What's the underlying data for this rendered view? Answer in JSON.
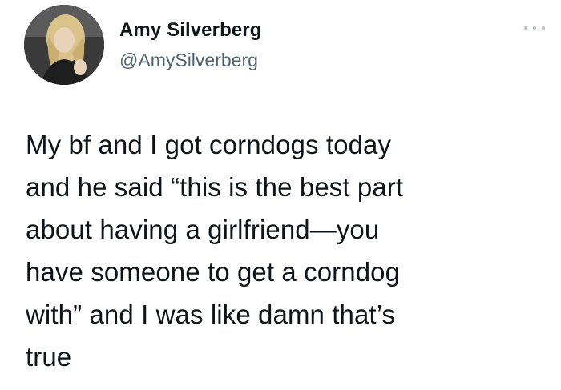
{
  "tweet": {
    "author": {
      "display_name": "Amy Silverberg",
      "handle": "@AmySilverberg",
      "avatar_icon": "user-avatar"
    },
    "more_icon": "more-options-icon",
    "text_lines": [
      "My bf and I got corndogs today",
      "and he said “this is the best part",
      "about having a girlfriend—you",
      "have someone to get a corndog",
      "with” and I was like damn that’s",
      "true"
    ]
  }
}
